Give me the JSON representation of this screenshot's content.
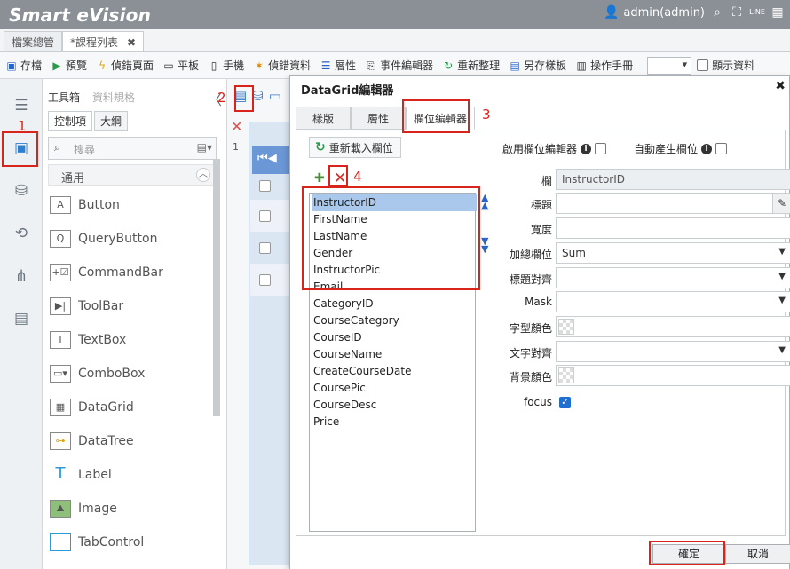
{
  "app": {
    "title": "Smart eVision",
    "user": "admin(admin)",
    "line_label": "LINE"
  },
  "file_tabs": [
    {
      "label": "檔案總管"
    },
    {
      "label": "*課程列表"
    }
  ],
  "toolbar": {
    "items": [
      "存檔",
      "預覽",
      "偵錯頁面",
      "平板",
      "手機",
      "偵錯資料",
      "層性",
      "事件編輯器",
      "重新整理",
      "另存樣板",
      "操作手冊"
    ],
    "show_data_label": "顯示資料"
  },
  "control_panel": {
    "top_tabs": [
      "工具箱",
      "資料規格"
    ],
    "tabs": [
      "控制項",
      "大綱"
    ],
    "search_placeholder": "搜尋",
    "group": "通用",
    "controls": [
      "Button",
      "QueryButton",
      "CommandBar",
      "ToolBar",
      "TextBox",
      "ComboBox",
      "DataGrid",
      "DataTree",
      "Label",
      "Image",
      "TabControl"
    ]
  },
  "design": {
    "line_number": "1"
  },
  "annotations": [
    "1",
    "2",
    "3",
    "4"
  ],
  "dialog": {
    "title": "DataGrid編輯器",
    "tabs": [
      "樣版",
      "層性",
      "欄位編輯器"
    ],
    "reload_label": "重新載入欄位",
    "enable_field_editor": "啟用欄位編輯器",
    "auto_generate_field": "自動產生欄位",
    "fields": [
      "InstructorID",
      "FirstName",
      "LastName",
      "Gender",
      "InstructorPic",
      "Email",
      "CategoryID",
      "CourseCategory",
      "CourseID",
      "CourseName",
      "CreateCourseDate",
      "CoursePic",
      "CourseDesc",
      "Price"
    ],
    "selected_field": "InstructorID",
    "props": {
      "column_label": "欄",
      "column_value": "InstructorID",
      "title_label": "標題",
      "title_value": "",
      "width_label": "寬度",
      "width_value": "",
      "aggregate_label": "加總欄位",
      "aggregate_value": "Sum",
      "title_align_label": "標題對齊",
      "title_align_value": "",
      "mask_label": "Mask",
      "mask_value": "",
      "font_color_label": "字型顏色",
      "text_align_label": "文字對齊",
      "text_align_value": "",
      "bg_color_label": "背景顏色",
      "focus_label": "focus"
    },
    "ok_label": "確定",
    "cancel_label": "取消"
  }
}
